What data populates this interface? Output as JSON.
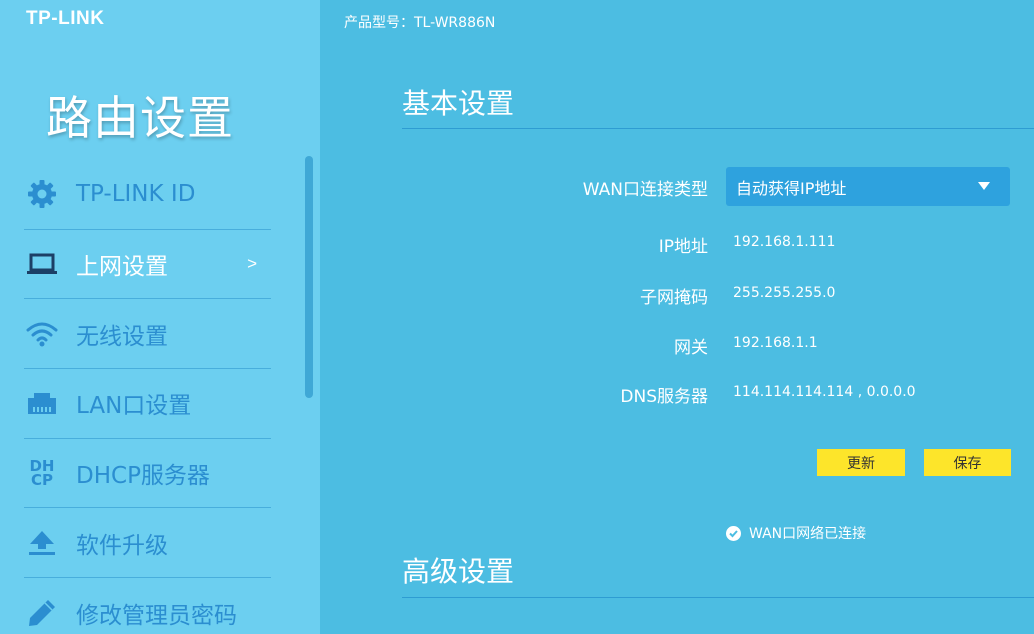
{
  "brand": {
    "logo": "TP-LINK"
  },
  "header": {
    "model_label": "产品型号：TL-WR886N"
  },
  "sidebar": {
    "title": "路由设置",
    "items": [
      {
        "label": "TP-LINK ID",
        "icon": "gear-icon",
        "active": false
      },
      {
        "label": "上网设置",
        "icon": "laptop-icon",
        "active": true,
        "chevron": ">"
      },
      {
        "label": "无线设置",
        "icon": "wifi-icon",
        "active": false
      },
      {
        "label": "LAN口设置",
        "icon": "lan-port-icon",
        "active": false
      },
      {
        "label": "DHCP服务器",
        "icon": "dhcp-icon",
        "active": false,
        "icon_text_top": "DH",
        "icon_text_bottom": "CP"
      },
      {
        "label": "软件升级",
        "icon": "upload-icon",
        "active": false
      },
      {
        "label": "修改管理员密码",
        "icon": "pencil-icon",
        "active": false
      }
    ]
  },
  "main": {
    "basic_title": "基本设置",
    "wan_type": {
      "label": "WAN口连接类型",
      "value": "自动获得IP地址"
    },
    "ip": {
      "label": "IP地址",
      "value": "192.168.1.111"
    },
    "mask": {
      "label": "子网掩码",
      "value": "255.255.255.0"
    },
    "gateway": {
      "label": "网关",
      "value": "192.168.1.1"
    },
    "dns": {
      "label": "DNS服务器",
      "value": "114.114.114.114 , 0.0.0.0"
    },
    "refresh_label": "更新",
    "save_label": "保存",
    "status_text": "WAN口网络已连接",
    "advanced_title": "高级设置"
  },
  "colors": {
    "sidebar_bg": "#6ccff0",
    "main_bg": "#4cbde2",
    "menu_text": "#2b8ed0",
    "button_yellow": "#fde52a",
    "select_bg": "#2ea2de"
  }
}
